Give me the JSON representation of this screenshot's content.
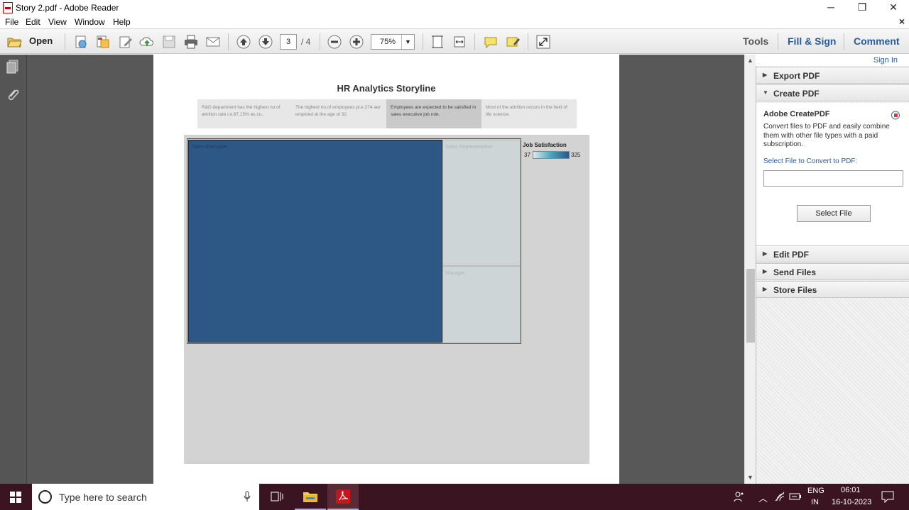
{
  "window": {
    "title": "Story 2.pdf - Adobe Reader",
    "minimize": "─",
    "restore": "❐",
    "close": "✕"
  },
  "menu": [
    "File",
    "Edit",
    "View",
    "Window",
    "Help"
  ],
  "menu_close": "×",
  "toolbar": {
    "open_label": "Open",
    "page_current": "3",
    "page_total": "/ 4",
    "zoom": "75%",
    "tools_label": "Tools",
    "fillsign_label": "Fill & Sign",
    "comment_label": "Comment"
  },
  "document": {
    "title": "HR Analytics Storyline",
    "story_points": [
      "R&D department has the highest no.of attrition rate i.e.67.15% as co..",
      "The highest no.of employees pi.e.274 aer emploed at the age of 32.",
      "Employees are expected to be satisfied in sales executive job role.",
      "Most of the attrition occurs in the field of life science."
    ],
    "treemap": {
      "cells": [
        "Sales Executive",
        "Sales Representative",
        "Manager"
      ],
      "legend_title": "Job Satisfaction",
      "legend_min": "37",
      "legend_max": "325"
    }
  },
  "right_pane": {
    "sign_in": "Sign In",
    "export_pdf": "Export PDF",
    "create_pdf": "Create PDF",
    "createpdf_heading": "Adobe CreatePDF",
    "createpdf_text": "Convert files to PDF and easily combine them with other file types with a paid subscription.",
    "select_label": "Select File to Convert to PDF:",
    "select_button": "Select File",
    "edit_pdf": "Edit PDF",
    "send_files": "Send Files",
    "store_files": "Store Files"
  },
  "taskbar": {
    "search_placeholder": "Type here to search",
    "lang": "ENG",
    "region": "IN",
    "time": "06:01",
    "date": "16-10-2023"
  },
  "colors": {
    "treemap_main": "#2d5886",
    "treemap_light": "#cdd5d7",
    "accent": "#2a5b9a",
    "taskbar": "#3a1420"
  }
}
